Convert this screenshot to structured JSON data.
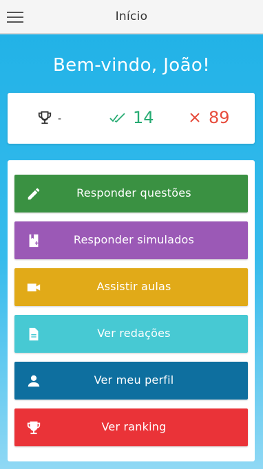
{
  "header": {
    "title": "Início",
    "menu_icon": "hamburger-menu-icon"
  },
  "welcome": {
    "text": "Bem-vindo, João!"
  },
  "stats": {
    "ranking_icon": "trophy-icon",
    "ranking_value": "-",
    "correct_icon": "double-check-icon",
    "correct_count": "14",
    "wrong_icon": "close-icon",
    "wrong_count": "89",
    "colors": {
      "correct": "#26ab72",
      "wrong": "#e74c3c"
    }
  },
  "actions": [
    {
      "label": "Responder questões",
      "icon": "pencil-icon",
      "color": "#3a9142"
    },
    {
      "label": "Responder simulados",
      "icon": "exam-add-icon",
      "color": "#9b59b6"
    },
    {
      "label": "Assistir aulas",
      "icon": "video-camera-icon",
      "color": "#e1aa18"
    },
    {
      "label": "Ver redações",
      "icon": "document-icon",
      "color": "#47c9d3"
    },
    {
      "label": "Ver meu perfil",
      "icon": "person-icon",
      "color": "#0e6f9f"
    },
    {
      "label": "Ver ranking",
      "icon": "trophy-icon",
      "color": "#ea3338"
    }
  ]
}
